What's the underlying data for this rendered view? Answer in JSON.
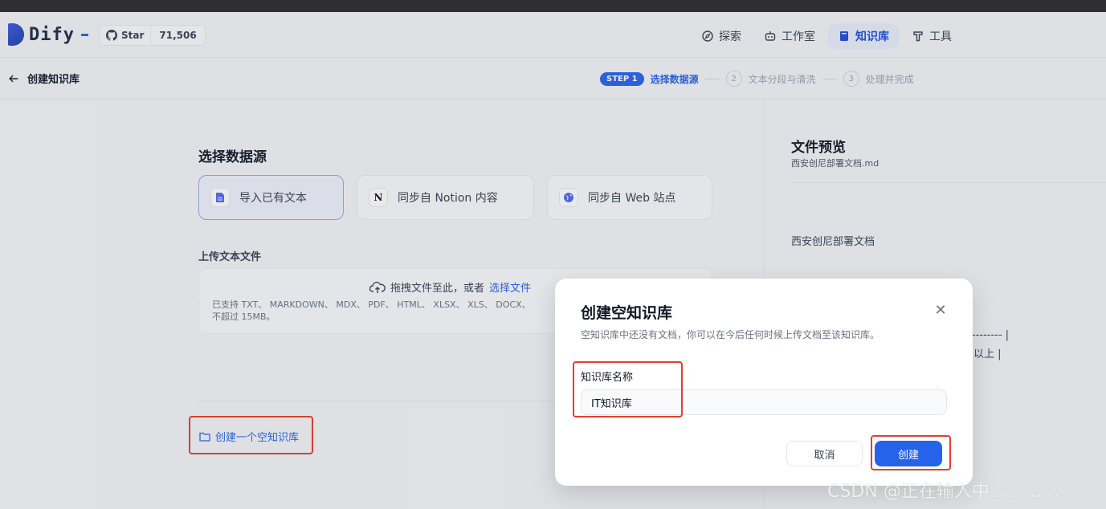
{
  "header": {
    "logo_text": "Dify",
    "github": {
      "star_label": "Star",
      "count": "71,506"
    },
    "nav": [
      {
        "label": "探索",
        "icon": "compass-icon"
      },
      {
        "label": "工作室",
        "icon": "robot-icon"
      },
      {
        "label": "知识库",
        "icon": "book-icon",
        "active": true
      },
      {
        "label": "工具",
        "icon": "hammer-icon"
      }
    ]
  },
  "subheader": {
    "back_title": "创建知识库",
    "steps": {
      "step1_badge": "STEP 1",
      "step1_label": "选择数据源",
      "step2_num": "2",
      "step2_label": "文本分段与清洗",
      "step3_num": "3",
      "step3_label": "处理并完成"
    }
  },
  "main": {
    "section_title": "选择数据源",
    "sources": [
      {
        "label": "导入已有文本",
        "icon": "file-text-icon",
        "active": true
      },
      {
        "label": "同步自 Notion 内容",
        "icon": "notion-icon"
      },
      {
        "label": "同步自 Web 站点",
        "icon": "globe-icon"
      }
    ],
    "upload_label": "上传文本文件",
    "dropzone": {
      "prompt": "拖拽文件至此，或者",
      "link": "选择文件",
      "support_line1": "已支持 TXT、 MARKDOWN、 MDX、 PDF、 HTML、 XLSX、 XLS、 DOCX、",
      "support_line2": "不超过 15MB。"
    },
    "empty_link": "创建一个空知识库"
  },
  "preview": {
    "title": "文件预览",
    "filename": "西安创尼部署文档.md",
    "body": "西安创尼部署文档",
    "fragment1": "-------- |",
    "fragment2": "以上 |"
  },
  "modal": {
    "title": "创建空知识库",
    "description": "空知识库中还没有文档，你可以在今后任何时候上传文档至该知识库。",
    "name_label": "知识库名称",
    "name_value": "IT知识库",
    "cancel_label": "取消",
    "create_label": "创建"
  },
  "watermark": "CSDN @正在输入中…………",
  "colors": {
    "accent": "#2563eb",
    "highlight": "#e53e2e"
  }
}
